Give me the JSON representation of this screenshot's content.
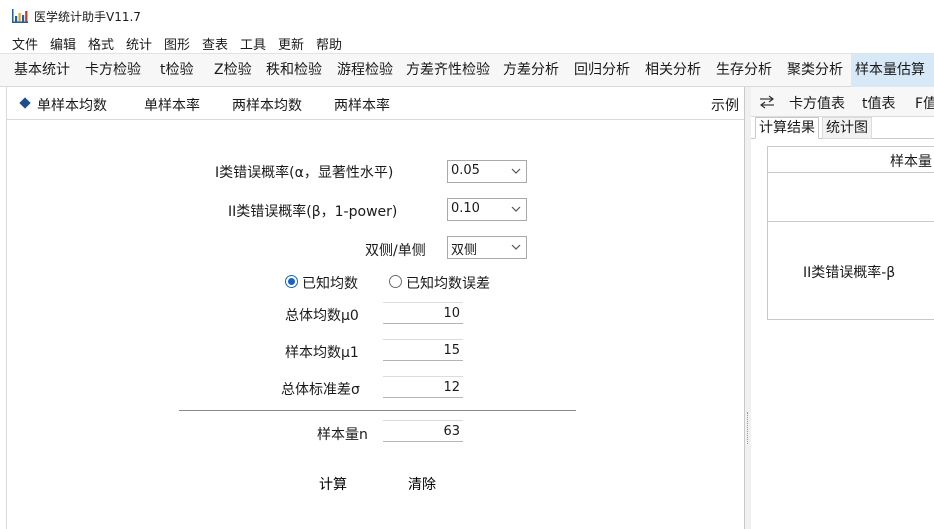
{
  "app": {
    "title": "医学统计助手V11.7",
    "accent_color": "#1565c0",
    "icon": "bar-chart-icon"
  },
  "menu": [
    "文件",
    "编辑",
    "格式",
    "统计",
    "图形",
    "查表",
    "工具",
    "更新",
    "帮助"
  ],
  "toolbar_tabs": [
    "基本统计",
    "卡方检验",
    "t检验",
    "Z检验",
    "秩和检验",
    "游程检验",
    "方差齐性检验",
    "方差分析",
    "回归分析",
    "相关分析",
    "生存分析",
    "聚类分析",
    "样本量估算"
  ],
  "toolbar_active": "样本量估算",
  "subtabs": [
    "单样本均数",
    "单样本率",
    "两样本均数",
    "两样本率"
  ],
  "subtab_active": "单样本均数",
  "example_label": "示例",
  "form": {
    "alpha_label": "I类错误概率(α，显著性水平)",
    "alpha_value": "0.05",
    "beta_label": "II类错误概率(β，1-power)",
    "beta_value": "0.10",
    "sides_label": "双侧/单侧",
    "sides_value": "双侧",
    "radio_known_mean": "已知均数",
    "radio_known_mean_error": "已知均数误差",
    "radio_selected": "已知均数",
    "mu0_label": "总体均数μ0",
    "mu0_value": "10",
    "mu1_label": "样本均数μ1",
    "mu1_value": "15",
    "sigma_label": "总体标准差σ",
    "sigma_value": "12",
    "n_label": "样本量n",
    "n_value": "63",
    "calc_button": "计算",
    "clear_button": "清除"
  },
  "right": {
    "toolbar": [
      "卡方值表",
      "t值表",
      "F值"
    ],
    "swap_icon": "swap-arrows-icon",
    "tabs": [
      "计算结果",
      "统计图"
    ],
    "tab_active": "计算结果",
    "table_header": "样本量",
    "table_row_label": "II类错误概率-β"
  }
}
